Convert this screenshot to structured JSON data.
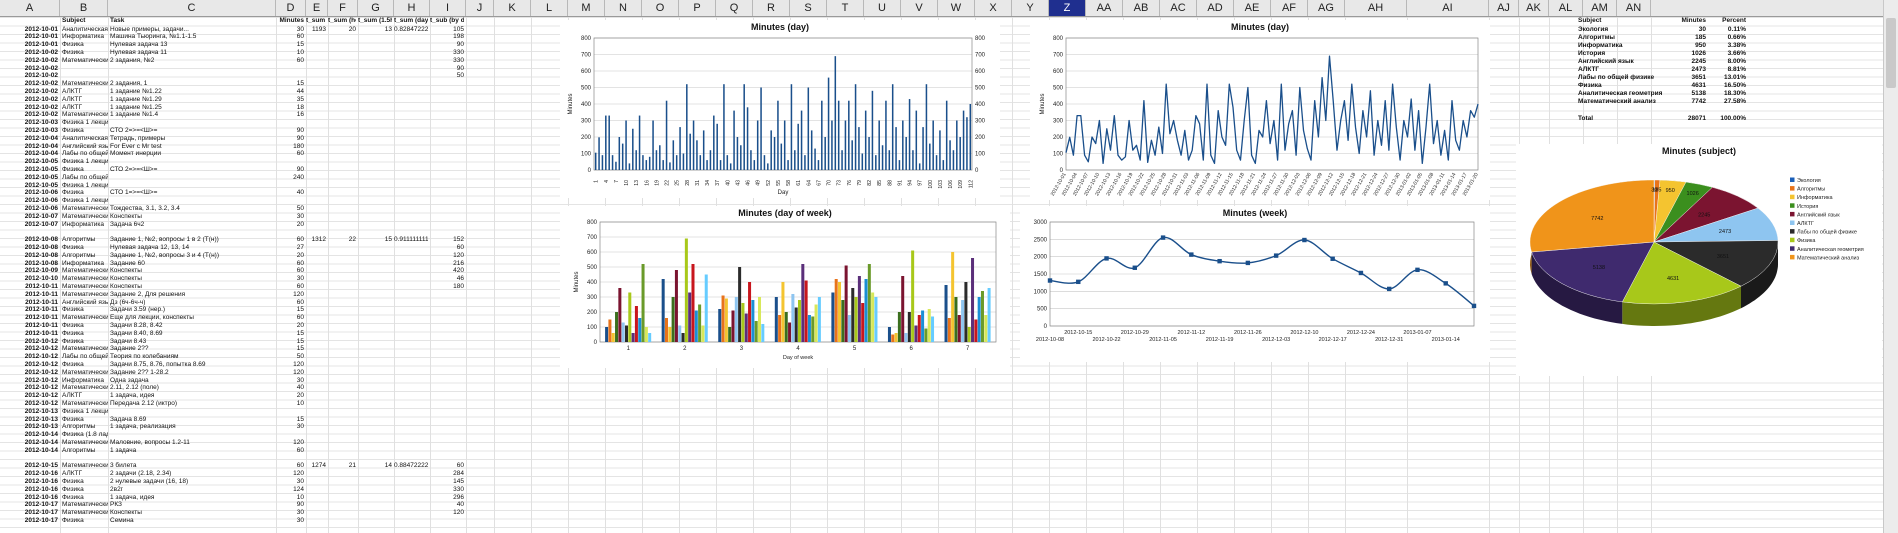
{
  "columns": [
    "A",
    "B",
    "C",
    "D",
    "E",
    "F",
    "G",
    "H",
    "I",
    "J",
    "K",
    "L",
    "M",
    "N",
    "O",
    "P",
    "Q",
    "R",
    "S",
    "T",
    "U",
    "V",
    "W",
    "X",
    "Y",
    "Z",
    "AA",
    "AB",
    "AC",
    "AD",
    "AE",
    "AF",
    "AG",
    "AH",
    "AI",
    "AJ",
    "AK",
    "AL",
    "AM",
    "AN"
  ],
  "selected_column": "Z",
  "header_row": [
    "",
    "Subject",
    "Task",
    "Minutes",
    "t_sum (h)",
    "t_sum (hour)",
    "t_sum (1.5hour)",
    "t_sum (days)",
    "t_sub (by day)"
  ],
  "rows": [
    [
      "2012-10-01",
      "Аналитическая геометр.",
      "Новые примеры, задачи...",
      "30",
      "1193",
      "20",
      "13",
      "0.8284722222",
      "105"
    ],
    [
      "2012-10-01",
      "Информатика",
      "Машина Тьюринга, №1.1-1.5",
      "60",
      "",
      "",
      "",
      "",
      "198"
    ],
    [
      "2012-10-01",
      "Физика",
      "Нулевая задача 13",
      "15",
      "",
      "",
      "",
      "",
      "90"
    ],
    [
      "2012-10-02",
      "Физика",
      "Нулевая задача 11",
      "10",
      "",
      "",
      "",
      "",
      "330"
    ],
    [
      "2012-10-02",
      "Математический анализ",
      "2 задания, №2",
      "60",
      "",
      "",
      "",
      "",
      "330"
    ],
    [
      "2012-10-02",
      "",
      "",
      "",
      "",
      "",
      "",
      "",
      "90"
    ],
    [
      "2012-10-02",
      "",
      "",
      "",
      "",
      "",
      "",
      "",
      "50"
    ],
    [
      "2012-10-02",
      "Математический анализ",
      "2 задания, 1",
      "15",
      "",
      "",
      "",
      "",
      ""
    ],
    [
      "2012-10-02",
      "АЛКТГ",
      "1 задание №1.22",
      "44",
      "",
      "",
      "",
      "",
      ""
    ],
    [
      "2012-10-02",
      "АЛКТГ",
      "1 задание №1.29",
      "35",
      "",
      "",
      "",
      "",
      ""
    ],
    [
      "2012-10-02",
      "АЛКТГ",
      "1 задание №1.25",
      "18",
      "",
      "",
      "",
      "",
      ""
    ],
    [
      "2012-10-02",
      "Математический анализ",
      "1 задание №1.4",
      "16",
      "",
      "",
      "",
      "",
      ""
    ],
    [
      "2012-10-03",
      "Физика 1 лекция",
      "",
      "",
      "",
      "",
      "",
      "",
      ""
    ],
    [
      "2012-10-03",
      "Физика",
      "СТО 2=>=<Ш>=",
      "90",
      "",
      "",
      "",
      "",
      ""
    ],
    [
      "2012-10-04",
      "Аналитическая геометр.",
      "Тетрадь, примеры",
      "90",
      "",
      "",
      "",
      "",
      ""
    ],
    [
      "2012-10-04",
      "Английский язык",
      "For Ever с Mr test",
      "180",
      "",
      "",
      "",
      "",
      ""
    ],
    [
      "2012-10-04",
      "Лабы по общей физике",
      "Момент инерции",
      "60",
      "",
      "",
      "",
      "",
      ""
    ],
    [
      "2012-10-05",
      "Физика 1 лекция",
      "",
      "",
      "",
      "",
      "",
      "",
      ""
    ],
    [
      "2012-10-05",
      "Физика",
      "СТО 2=>=<Ш>=",
      "90",
      "",
      "",
      "",
      "",
      ""
    ],
    [
      "2012-10-05",
      "Лабы по общей физике",
      "",
      "240",
      "",
      "",
      "",
      "",
      ""
    ],
    [
      "2012-10-05",
      "Физика 1 лекция",
      "",
      "",
      "",
      "",
      "",
      "",
      ""
    ],
    [
      "2012-10-06",
      "Физика",
      "СТО 1=>=<Ш>=",
      "40",
      "",
      "",
      "",
      "",
      ""
    ],
    [
      "2012-10-06",
      "Физика 1 лекция",
      "",
      "",
      "",
      "",
      "",
      "",
      ""
    ],
    [
      "2012-10-06",
      "Математический анализ",
      "Тождества, 3.1, 3.2, 3.4",
      "50",
      "",
      "",
      "",
      "",
      ""
    ],
    [
      "2012-10-07",
      "Математический анализ",
      "Конспекты",
      "30",
      "",
      "",
      "",
      "",
      ""
    ],
    [
      "2012-10-07",
      "Информатика",
      "Задача 6ч2",
      "20",
      "",
      "",
      "",
      "",
      ""
    ],
    [
      "",
      "",
      "",
      "",
      "",
      "",
      "",
      "",
      ""
    ],
    [
      "2012-10-08",
      "Алгоритмы",
      "Задание 1, №2, вопросы 1 в 2 (Т(н))",
      "60",
      "1312",
      "22",
      "15",
      "0.9111111111",
      "152"
    ],
    [
      "2012-10-08",
      "Физика",
      "Нулевая задача 12, 13, 14",
      "27",
      "",
      "",
      "",
      "",
      "60"
    ],
    [
      "2012-10-08",
      "Алгоритмы",
      "Задание 1, №2, вопросы 3 и 4 (Т(н))",
      "20",
      "",
      "",
      "",
      "",
      "120"
    ],
    [
      "2012-10-08",
      "Информатика",
      "Задание 60",
      "60",
      "",
      "",
      "",
      "",
      "216"
    ],
    [
      "2012-10-09",
      "Математический анализ",
      "Конспекты",
      "60",
      "",
      "",
      "",
      "",
      "420"
    ],
    [
      "2012-10-10",
      "Математический анализ",
      "Конспекты",
      "30",
      "",
      "",
      "",
      "",
      "46"
    ],
    [
      "2012-10-11",
      "Математический анализ",
      "Конспекты",
      "60",
      "",
      "",
      "",
      "",
      "180"
    ],
    [
      "2012-10-11",
      "Математический анализ",
      "Задание 2, Для решения",
      "120",
      "",
      "",
      "",
      "",
      ""
    ],
    [
      "2012-10-11",
      "Английский язык",
      "Дз (6ч-6ч-ч)",
      "60",
      "",
      "",
      "",
      "",
      ""
    ],
    [
      "2012-10-11",
      "Физика",
      "Задачи 3.59 (нер.)",
      "15",
      "",
      "",
      "",
      "",
      ""
    ],
    [
      "2012-10-11",
      "Математический анализ",
      "Еще для лекции, конспекты",
      "60",
      "",
      "",
      "",
      "",
      ""
    ],
    [
      "2012-10-11",
      "Физика",
      "Задачи 8.28, 8.42",
      "20",
      "",
      "",
      "",
      "",
      ""
    ],
    [
      "2012-10-11",
      "Физика",
      "Задачи 8.40, 8.69",
      "15",
      "",
      "",
      "",
      "",
      ""
    ],
    [
      "2012-10-12",
      "Физика",
      "Задачи 8.43",
      "15",
      "",
      "",
      "",
      "",
      ""
    ],
    [
      "2012-10-12",
      "Математический анализ",
      "Задание 2??",
      "15",
      "",
      "",
      "",
      "",
      ""
    ],
    [
      "2012-10-12",
      "Лабы по общей физике",
      "Теория по колебаниям",
      "50",
      "",
      "",
      "",
      "",
      ""
    ],
    [
      "2012-10-12",
      "Физика",
      "Задачи 8.75, 8.76, попытка 8.69",
      "120",
      "",
      "",
      "",
      "",
      ""
    ],
    [
      "2012-10-12",
      "Математический анализ",
      "Задание 2?? 1-28.2",
      "120",
      "",
      "",
      "",
      "",
      ""
    ],
    [
      "2012-10-12",
      "Информатика",
      "Одна задача",
      "30",
      "",
      "",
      "",
      "",
      ""
    ],
    [
      "2012-10-12",
      "Математический анализ",
      "2.11, 2.12 (поле)",
      "40",
      "",
      "",
      "",
      "",
      ""
    ],
    [
      "2012-10-12",
      "АЛКТГ",
      "1 задача, идея",
      "20",
      "",
      "",
      "",
      "",
      ""
    ],
    [
      "2012-10-12",
      "Математический анализ",
      "Передача 2.12 (иктро)",
      "10",
      "",
      "",
      "",
      "",
      ""
    ],
    [
      "2012-10-13",
      "Физика 1 лекция",
      "",
      "",
      "",
      "",
      "",
      "",
      ""
    ],
    [
      "2012-10-13",
      "Физика",
      "Задача 8.69",
      "15",
      "",
      "",
      "",
      "",
      ""
    ],
    [
      "2012-10-13",
      "Алгоритмы",
      "1 задача, реализация",
      "30",
      "",
      "",
      "",
      "",
      ""
    ],
    [
      "2012-10-14",
      "Физика (1.8 ладач)",
      "",
      "",
      "",
      "",
      "",
      "",
      ""
    ],
    [
      "2012-10-14",
      "Математический анализ",
      "Маловние, вопросы 1.2-11",
      "120",
      "",
      "",
      "",
      "",
      ""
    ],
    [
      "2012-10-14",
      "Алгоритмы",
      "1 задача",
      "60",
      "",
      "",
      "",
      "",
      ""
    ],
    [
      "",
      "",
      "",
      "",
      "",
      "",
      "",
      "",
      ""
    ],
    [
      "2012-10-15",
      "Математический анализ",
      "3 билета",
      "60",
      "1274",
      "21",
      "14",
      "0.8847222222",
      "60"
    ],
    [
      "2012-10-16",
      "АЛКТГ",
      "2 задачи (2.18, 2.34)",
      "120",
      "",
      "",
      "",
      "",
      "284"
    ],
    [
      "2012-10-16",
      "Физика",
      "2 нулевые задачи (16, 18)",
      "30",
      "",
      "",
      "",
      "",
      "145"
    ],
    [
      "2012-10-16",
      "Физика",
      "2в2г",
      "124",
      "",
      "",
      "",
      "",
      "330"
    ],
    [
      "2012-10-16",
      "Физика",
      "1 задача, идея",
      "10",
      "",
      "",
      "",
      "",
      "296"
    ],
    [
      "2012-10-17",
      "Математический анализ",
      "РКЗ",
      "90",
      "",
      "",
      "",
      "",
      "40"
    ],
    [
      "2012-10-17",
      "Математический анализ",
      "Конспекты",
      "30",
      "",
      "",
      "",
      "",
      "120"
    ],
    [
      "2012-10-17",
      "Физика",
      "Семина",
      "30",
      "",
      "",
      "",
      "",
      ""
    ]
  ],
  "subject_table": {
    "headers": [
      "Subject",
      "Minutes",
      "Percent"
    ],
    "rows": [
      [
        "Экология",
        "30",
        "0.11%"
      ],
      [
        "Алгоритмы",
        "185",
        "0.66%"
      ],
      [
        "Информатика",
        "950",
        "3.38%"
      ],
      [
        "История",
        "1026",
        "3.66%"
      ],
      [
        "Английский язык",
        "2245",
        "8.00%"
      ],
      [
        "АЛКТГ",
        "2473",
        "8.81%"
      ],
      [
        "Лабы по общей физике",
        "3651",
        "13.01%"
      ],
      [
        "Физика",
        "4631",
        "16.50%"
      ],
      [
        "Аналитическая геометрия",
        "5138",
        "18.30%"
      ],
      [
        "Математический анализ",
        "7742",
        "27.58%"
      ]
    ],
    "total_label": "Total",
    "total_minutes": "28071",
    "total_percent": "100.00%"
  },
  "chart_data": [
    {
      "type": "bar",
      "title": "Minutes (day)",
      "xlabel": "Day",
      "ylabel": "Minutes",
      "ylim": [
        0,
        800
      ],
      "yticks": [
        0,
        100,
        200,
        300,
        400,
        500,
        600,
        700,
        800
      ],
      "xtick_labels": [
        "1",
        "4",
        "7",
        "10",
        "13",
        "16",
        "19",
        "22",
        "25",
        "28",
        "31",
        "34",
        "37",
        "40",
        "43",
        "46",
        "49",
        "52",
        "55",
        "58",
        "61",
        "64",
        "67",
        "70",
        "73",
        "76",
        "79",
        "82",
        "85",
        "88",
        "91",
        "94",
        "97",
        "100",
        "103",
        "106",
        "109",
        "112"
      ],
      "color": "#1a4f8b",
      "values": [
        105,
        198,
        90,
        330,
        330,
        90,
        50,
        200,
        160,
        300,
        40,
        250,
        120,
        330,
        90,
        60,
        80,
        300,
        120,
        150,
        60,
        420,
        46,
        180,
        90,
        260,
        100,
        520,
        220,
        300,
        180,
        90,
        240,
        60,
        120,
        330,
        280,
        60,
        520,
        90,
        40,
        360,
        200,
        150,
        520,
        380,
        120,
        60,
        300,
        500,
        90,
        40,
        240,
        200,
        420,
        160,
        300,
        60,
        520,
        120,
        280,
        360,
        90,
        500,
        240,
        130,
        60,
        420,
        200,
        560,
        300,
        690,
        420,
        120,
        300,
        420,
        180,
        520,
        260,
        100,
        360,
        200,
        480,
        90,
        300,
        150,
        420,
        120,
        520,
        260,
        60,
        300,
        200,
        430,
        120,
        360,
        40,
        260,
        520,
        160,
        300,
        90,
        240,
        60,
        420,
        180,
        120,
        300,
        200,
        360,
        320,
        400
      ]
    },
    {
      "type": "line",
      "title": "Minutes (day)",
      "xlabel": "",
      "ylabel": "Minutes",
      "ylim": [
        0,
        800
      ],
      "yticks": [
        0,
        100,
        200,
        300,
        400,
        500,
        600,
        700,
        800
      ],
      "xtick_labels": [
        "2012-10-01",
        "2012-10-04",
        "2012-10-07",
        "2012-10-10",
        "2012-10-13",
        "2012-10-16",
        "2012-10-19",
        "2012-10-22",
        "2012-10-25",
        "2012-10-28",
        "2012-10-31",
        "2012-11-03",
        "2012-11-06",
        "2012-11-09",
        "2012-11-12",
        "2012-11-15",
        "2012-11-18",
        "2012-11-21",
        "2012-11-24",
        "2012-11-27",
        "2012-11-30",
        "2012-12-03",
        "2012-12-06",
        "2012-12-09",
        "2012-12-12",
        "2012-12-15",
        "2012-12-18",
        "2012-12-21",
        "2012-12-24",
        "2012-12-27",
        "2012-12-30",
        "2013-01-02",
        "2013-01-05",
        "2013-01-08",
        "2013-01-11",
        "2013-01-14",
        "2013-01-17",
        "2013-01-20"
      ],
      "color": "#1a4f8b",
      "values": [
        105,
        198,
        90,
        330,
        330,
        90,
        50,
        200,
        160,
        300,
        40,
        250,
        120,
        330,
        90,
        60,
        80,
        300,
        120,
        150,
        60,
        420,
        46,
        180,
        90,
        260,
        100,
        520,
        220,
        300,
        180,
        90,
        240,
        60,
        120,
        330,
        280,
        60,
        520,
        90,
        40,
        360,
        200,
        150,
        520,
        380,
        120,
        60,
        300,
        500,
        90,
        40,
        240,
        200,
        420,
        160,
        300,
        60,
        520,
        120,
        280,
        360,
        90,
        500,
        240,
        130,
        60,
        420,
        200,
        560,
        300,
        690,
        420,
        120,
        300,
        420,
        180,
        520,
        260,
        100,
        360,
        200,
        480,
        90,
        300,
        150,
        420,
        120,
        520,
        260,
        60,
        300,
        200,
        430,
        120,
        360,
        40,
        260,
        520,
        160,
        300,
        90,
        240,
        60,
        420,
        180,
        120,
        300,
        200,
        360,
        320,
        400
      ]
    },
    {
      "type": "bar",
      "title": "Minutes (day of week)",
      "xlabel": "Day of week",
      "ylabel": "Minutes",
      "ylim": [
        0,
        800
      ],
      "yticks": [
        0,
        100,
        200,
        300,
        400,
        500,
        600,
        700,
        800
      ],
      "categories": [
        "1",
        "2",
        "3",
        "4",
        "5",
        "6",
        "7"
      ],
      "colors": [
        "#1a4f8b",
        "#e8731a",
        "#f4c430",
        "#3b6f1e",
        "#7b1430",
        "#8ec5f0",
        "#2b2b2b",
        "#a8c81a",
        "#5b2f7a",
        "#c8161d",
        "#1b8fd6",
        "#6a9a2a",
        "#d8e85a",
        "#66ccff"
      ],
      "groups": [
        [
          100,
          150,
          60,
          200,
          360,
          130,
          110,
          330,
          60,
          240,
          160,
          520,
          100,
          60
        ],
        [
          420,
          160,
          100,
          300,
          480,
          110,
          60,
          690,
          330,
          520,
          210,
          250,
          110,
          450
        ],
        [
          220,
          310,
          290,
          100,
          210,
          300,
          500,
          260,
          190,
          400,
          280,
          140,
          300,
          120
        ],
        [
          300,
          180,
          400,
          200,
          130,
          320,
          230,
          280,
          520,
          410,
          180,
          170,
          250,
          300
        ],
        [
          330,
          420,
          400,
          280,
          510,
          180,
          360,
          300,
          440,
          260,
          420,
          520,
          330,
          300
        ],
        [
          100,
          50,
          60,
          200,
          440,
          60,
          200,
          610,
          110,
          180,
          210,
          90,
          220,
          170
        ],
        [
          380,
          160,
          600,
          300,
          180,
          280,
          400,
          100,
          560,
          150,
          300,
          340,
          180,
          360
        ]
      ]
    },
    {
      "type": "line",
      "title": "Minutes (week)",
      "xlabel": "",
      "ylabel": "",
      "ylim": [
        0,
        3000
      ],
      "yticks": [
        0,
        500,
        1000,
        1500,
        2000,
        2500,
        3000
      ],
      "categories": [
        "2012-10-08",
        "2012-10-15",
        "2012-10-22",
        "2012-10-29",
        "2012-11-05",
        "2012-11-12",
        "2012-11-19",
        "2012-11-26",
        "2012-12-03",
        "2012-12-10",
        "2012-12-17",
        "2012-12-24",
        "2012-12-31",
        "2013-01-07",
        "2013-01-14",
        "2013-01-21"
      ],
      "xtick_labels": [
        "2012-10-08",
        "2012-10-15",
        "2012-10-22",
        "2012-10-29",
        "2012-11-05",
        "2012-11-12",
        "2012-11-19",
        "2012-11-26",
        "2012-12-03",
        "2012-12-10",
        "2012-12-17",
        "2012-12-24",
        "2012-12-31",
        "2013-01-07",
        "2013-01-14"
      ],
      "color": "#1a4f8b",
      "values": [
        1312,
        1274,
        1950,
        1680,
        2550,
        2060,
        1870,
        1820,
        2030,
        2480,
        1940,
        1530,
        1070,
        1620,
        1230,
        580
      ]
    },
    {
      "type": "pie",
      "title": "Minutes (subject)",
      "categories": [
        "Экология",
        "Алгоритмы",
        "Информатика",
        "История",
        "Английский язык",
        "АЛКТГ",
        "Лабы по общей физике",
        "Физика",
        "Аналитическая геометрия",
        "Математический анализ"
      ],
      "values": [
        30,
        185,
        950,
        1026,
        2245,
        2473,
        3651,
        4631,
        5138,
        7742
      ],
      "colors": [
        "#1b5fb8",
        "#e8731a",
        "#f4c430",
        "#3b8f1e",
        "#7b1430",
        "#8ec5f0",
        "#2b2b2b",
        "#a8c81a",
        "#3f2a6e",
        "#f0941a"
      ]
    }
  ]
}
